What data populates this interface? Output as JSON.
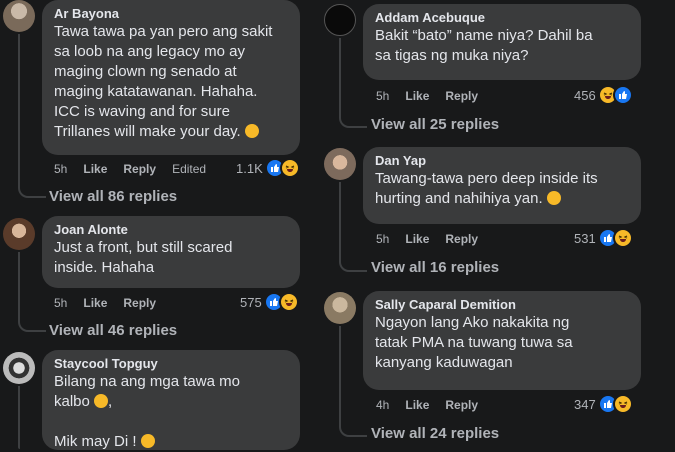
{
  "left": [
    {
      "name": "Ar Bayona",
      "text": "Tawa tawa pa yan pero ang sakit\nsa loob na ang legacy mo ay\nmaging clown ng senado at\nmaging katatawanan. Hahaha.\nICC is waving and for sure\nTrillanes will make your day. ",
      "time": "5h",
      "like": "Like",
      "reply": "Reply",
      "edited": "Edited",
      "reactions": "1.1K",
      "view_replies": "View all 86 replies"
    },
    {
      "name": "Joan Alonte",
      "text": "Just a front, but still scared\ninside. Hahaha",
      "time": "5h",
      "like": "Like",
      "reply": "Reply",
      "reactions": "575",
      "view_replies": "View all 46 replies"
    },
    {
      "name": "Staycool Topguy",
      "text_line1": "Bilang na ang mga tawa mo",
      "text_line2": "kalbo ",
      "text_line3": ",",
      "text_line4": "Mik may Di ! "
    }
  ],
  "right": [
    {
      "name": "Addam Acebuque",
      "text": "Bakit “bato” name niya? Dahil ba\nsa tigas ng muka niya?",
      "time": "5h",
      "like": "Like",
      "reply": "Reply",
      "reactions": "456",
      "view_replies": "View all 25 replies"
    },
    {
      "name": "Dan Yap",
      "text": "Tawang-tawa pero deep inside its\nhurting and nahihiya yan. ",
      "time": "5h",
      "like": "Like",
      "reply": "Reply",
      "reactions": "531",
      "view_replies": "View all 16 replies"
    },
    {
      "name": "Sally Caparal Demition",
      "text": "Ngayon lang Ako nakakita ng\ntatak PMA na tuwang tuwa sa\nkanyang kaduwagan",
      "time": "4h",
      "like": "Like",
      "reply": "Reply",
      "reactions": "347",
      "view_replies": "View all 24 replies"
    }
  ],
  "colors": {
    "bg": "#18191a",
    "bubble": "#3a3b3c",
    "like": "#1877f2",
    "haha": "#f7b928"
  }
}
